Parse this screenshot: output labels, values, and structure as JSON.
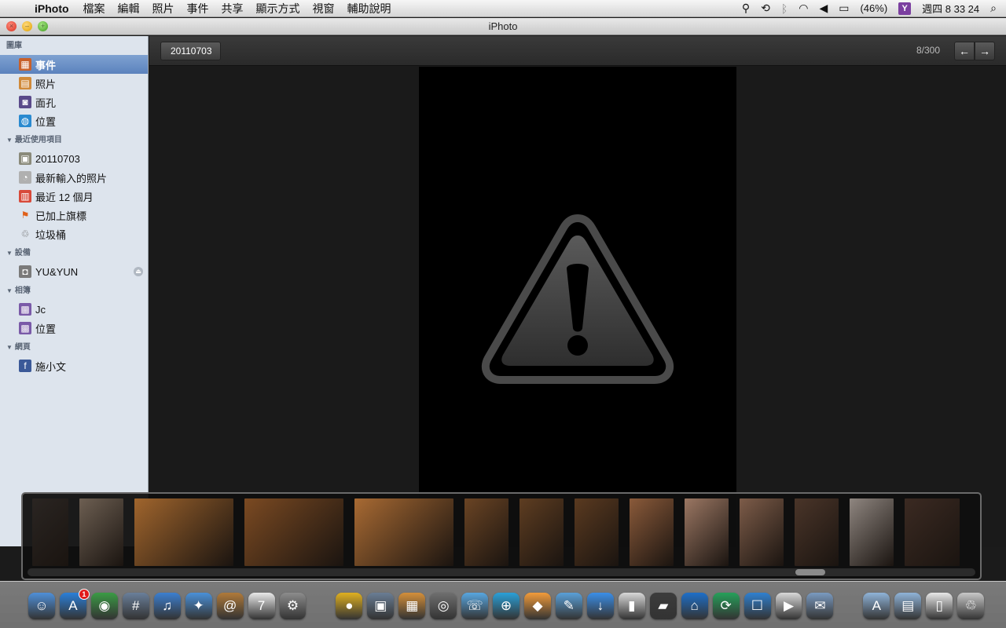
{
  "menubar": {
    "app_name": "iPhoto",
    "menus": [
      "檔案",
      "編輯",
      "照片",
      "事件",
      "共享",
      "顯示方式",
      "視窗",
      "輔助說明"
    ],
    "battery": "(46%)",
    "clock": "週四 8 33 24"
  },
  "window": {
    "title": "iPhoto"
  },
  "sidebar": {
    "sections": [
      {
        "header": "圖庫",
        "collapsible": false,
        "items": [
          {
            "label": "事件",
            "icon": "events-icon",
            "selected": true
          },
          {
            "label": "照片",
            "icon": "photos-icon"
          },
          {
            "label": "面孔",
            "icon": "faces-icon"
          },
          {
            "label": "位置",
            "icon": "globe-icon"
          }
        ]
      },
      {
        "header": "最近使用項目",
        "collapsible": true,
        "items": [
          {
            "label": "20110703",
            "icon": "event-album-icon"
          },
          {
            "label": "最新輸入的照片",
            "icon": "last-import-icon"
          },
          {
            "label": "最近 12 個月",
            "icon": "calendar-icon"
          },
          {
            "label": "已加上旗標",
            "icon": "flag-icon"
          },
          {
            "label": "垃圾桶",
            "icon": "trash-icon"
          }
        ]
      },
      {
        "header": "設備",
        "collapsible": true,
        "items": [
          {
            "label": "YU&YUN",
            "icon": "camera-icon",
            "eject": true
          }
        ]
      },
      {
        "header": "相簿",
        "collapsible": true,
        "items": [
          {
            "label": "Jc",
            "icon": "album-icon"
          },
          {
            "label": "位置",
            "icon": "album-icon"
          }
        ]
      },
      {
        "header": "網頁",
        "collapsible": true,
        "items": [
          {
            "label": "施小文",
            "icon": "facebook-icon"
          }
        ]
      }
    ]
  },
  "toolbar": {
    "event_button": "20110703",
    "counter": "8/300"
  },
  "colors": {
    "selection": "#5b82bd",
    "sidebar_bg": "#dde4ed",
    "viewer_bg": "#1a1a1a"
  },
  "filmstrip": {
    "thumbs": [
      {
        "color": "#2a2522",
        "w": 46
      },
      {
        "color": "#6d5f52",
        "w": 56
      },
      {
        "color": "#a0652d",
        "w": 126
      },
      {
        "color": "#7b4a22",
        "w": 126
      },
      {
        "color": "#a86a33",
        "w": 126
      },
      {
        "color": "#6a4424",
        "w": 56
      },
      {
        "color": "#5e3d21",
        "w": 56
      },
      {
        "color": "#5a3a20",
        "w": 56
      },
      {
        "color": "#8a5a3a",
        "w": 56
      },
      {
        "color": "#9b7763",
        "w": 56
      },
      {
        "color": "#7d5c49",
        "w": 56
      },
      {
        "color": "#4a3529",
        "w": 56
      },
      {
        "color": "#8f8680",
        "w": 56
      },
      {
        "color": "#3b2a22",
        "w": 70
      }
    ],
    "scroll_position": 0.81
  },
  "dock": {
    "apps": [
      {
        "name": "finder-icon",
        "glyph": "☺",
        "color": "#4f8fd8"
      },
      {
        "name": "app-store-icon",
        "glyph": "A",
        "color": "#2b7fd8",
        "badge": "1"
      },
      {
        "name": "chrome-icon",
        "glyph": "◉",
        "color": "#3b9b45"
      },
      {
        "name": "dashboard-icon",
        "glyph": "#",
        "color": "#6a7f9a"
      },
      {
        "name": "itunes-icon",
        "glyph": "♫",
        "color": "#3c7fd0"
      },
      {
        "name": "safari-icon",
        "glyph": "✦",
        "color": "#4a90d8"
      },
      {
        "name": "address-book-icon",
        "glyph": "@",
        "color": "#b07a3a"
      },
      {
        "name": "ical-icon",
        "glyph": "7",
        "color": "#e9e9e9"
      },
      {
        "name": "system-preferences-icon",
        "glyph": "⚙",
        "color": "#8c8c8c"
      },
      {
        "name": "gap"
      },
      {
        "name": "colorsync-icon",
        "glyph": "●",
        "color": "#e0b020"
      },
      {
        "name": "vmware-icon",
        "glyph": "▣",
        "color": "#6a7d94"
      },
      {
        "name": "iphoto-icon",
        "glyph": "▦",
        "color": "#d48f3a"
      },
      {
        "name": "photo-booth-icon",
        "glyph": "◎",
        "color": "#6f6f6f"
      },
      {
        "name": "facetime-icon",
        "glyph": "☏",
        "color": "#58a6e0"
      },
      {
        "name": "quicktime-icon",
        "glyph": "⊕",
        "color": "#2aa0d8"
      },
      {
        "name": "transmit-icon",
        "glyph": "◆",
        "color": "#f29b3a"
      },
      {
        "name": "preview-icon",
        "glyph": "✎",
        "color": "#5aa0d8"
      },
      {
        "name": "downloads-icon",
        "glyph": "↓",
        "color": "#3b8ee8"
      },
      {
        "name": "monitor-icon",
        "glyph": "▮",
        "color": "#d8d8d8"
      },
      {
        "name": "ps3-icon",
        "glyph": "▰",
        "color": "#3c3c3c"
      },
      {
        "name": "home-icon",
        "glyph": "⌂",
        "color": "#1e6fc8"
      },
      {
        "name": "cleaner-icon",
        "glyph": "⟳",
        "color": "#26a05a"
      },
      {
        "name": "iphone-sync-icon",
        "glyph": "☐",
        "color": "#2f80d0"
      },
      {
        "name": "dvd-player-icon",
        "glyph": "▶",
        "color": "#d8d8d8"
      },
      {
        "name": "photos-folder-icon",
        "glyph": "✉",
        "color": "#7a9ac0"
      },
      {
        "name": "gap"
      },
      {
        "name": "applications-folder-icon",
        "glyph": "A",
        "color": "#8fb3d8"
      },
      {
        "name": "documents-folder-icon",
        "glyph": "▤",
        "color": "#8fb3d8"
      },
      {
        "name": "document-icon",
        "glyph": "▯",
        "color": "#e8e8e8"
      },
      {
        "name": "trash-dock-icon",
        "glyph": "♲",
        "color": "#c8c8c8"
      }
    ]
  }
}
